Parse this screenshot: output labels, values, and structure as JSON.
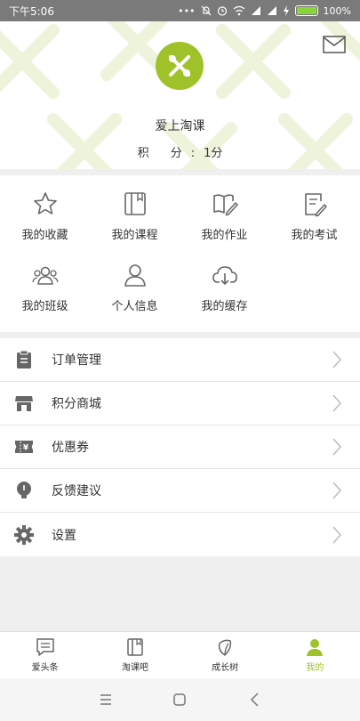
{
  "status_bar": {
    "time": "下午5:06",
    "battery": "100%"
  },
  "profile": {
    "name": "爱上淘课",
    "points_label": "积 分:",
    "points_value": "1分"
  },
  "colors": {
    "brand": "#9fc22a",
    "icon": "#666666"
  },
  "grid": {
    "items": [
      {
        "label": "我的收藏",
        "icon": "star-icon"
      },
      {
        "label": "我的课程",
        "icon": "book-icon"
      },
      {
        "label": "我的作业",
        "icon": "open-book-pen-icon"
      },
      {
        "label": "我的考试",
        "icon": "paper-pen-icon"
      },
      {
        "label": "我的班级",
        "icon": "group-icon"
      },
      {
        "label": "个人信息",
        "icon": "person-icon"
      },
      {
        "label": "我的缓存",
        "icon": "cloud-download-icon"
      }
    ]
  },
  "menu": {
    "items": [
      {
        "label": "订单管理",
        "icon": "clipboard-icon"
      },
      {
        "label": "积分商城",
        "icon": "store-icon"
      },
      {
        "label": "优惠券",
        "icon": "coupon-icon"
      },
      {
        "label": "反馈建议",
        "icon": "lightbulb-icon"
      },
      {
        "label": "设置",
        "icon": "gear-icon"
      }
    ]
  },
  "bottom_nav": {
    "items": [
      {
        "label": "爱头条",
        "icon": "news-icon"
      },
      {
        "label": "淘课吧",
        "icon": "book-icon"
      },
      {
        "label": "成长树",
        "icon": "leaf-icon"
      },
      {
        "label": "我的",
        "icon": "person-icon",
        "active": true
      }
    ]
  }
}
